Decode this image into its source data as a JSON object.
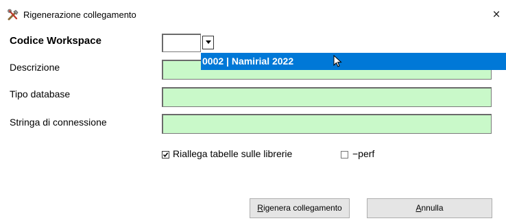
{
  "window": {
    "title": "Rigenerazione collegamento",
    "close_glyph": "×",
    "icon": "tools-icon"
  },
  "form": {
    "codice_label": "Codice Workspace",
    "codice_value": "",
    "descrizione_label": "Descrizione",
    "descrizione_value": "",
    "tipo_label": "Tipo database",
    "tipo_value": "",
    "stringa_label": "Stringa di connessione",
    "stringa_value": ""
  },
  "dropdown": {
    "options": [
      "0002 | Namirial 2022"
    ],
    "highlight_color": "#0078d7"
  },
  "options": {
    "riallega_label": "Riallega tabelle sulle librerie",
    "riallega_checked": true,
    "perf_label": "−perf",
    "perf_checked": false
  },
  "buttons": {
    "regen_first": "R",
    "regen_rest": "igenera collegamento",
    "annulla_first": "A",
    "annulla_rest": "nnulla"
  },
  "colors": {
    "field_bg": "#c9f9c9",
    "button_bg": "#e5e5e5"
  }
}
